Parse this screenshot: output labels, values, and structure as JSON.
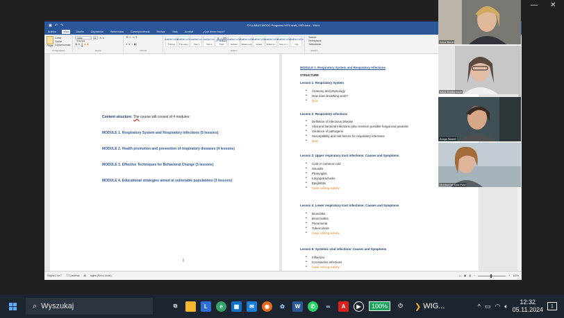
{
  "window": {
    "doc_title": "SYLLABUS MOOC Programa WP4 draft_V4Ů.docx - Word",
    "minimize": "—",
    "close": "✕"
  },
  "ribbon": {
    "tabs": [
      {
        "label": "Archivo"
      },
      {
        "label": "Inicio"
      },
      {
        "label": "Diseño"
      },
      {
        "label": "Disposición"
      },
      {
        "label": "Referencias"
      },
      {
        "label": "Correspondencia"
      },
      {
        "label": "Revisar"
      },
      {
        "label": "Vista"
      },
      {
        "label": "Acrobat"
      }
    ],
    "tell_me": "¿Qué desea hacer?",
    "clipboard": {
      "paste": "Pegar",
      "cut": "Cortar",
      "copy": "Copiar",
      "format_painter": "Copiar formato",
      "group": "Portapapeles"
    },
    "font": {
      "name": "Calibri (Cuerpo)",
      "size": "11",
      "group": "Fuente"
    },
    "paragraph": {
      "group": "Párrafo"
    },
    "styles": [
      {
        "sample": "AaBbCcDc",
        "name": "¶ Normal"
      },
      {
        "sample": "AaBbCcDc",
        "name": "¶ Sin espa..."
      },
      {
        "sample": "AaBbCcL",
        "name": "Título 1"
      },
      {
        "sample": "AaBbCcL",
        "name": "Título 2"
      },
      {
        "sample": "AaB",
        "name": "Título"
      },
      {
        "sample": "AaBbCcDc",
        "name": "Subtítulo"
      },
      {
        "sample": "AaBbCcDc",
        "name": "Énfasis sutil"
      },
      {
        "sample": "AaBbCcDc",
        "name": "Énfasis"
      },
      {
        "sample": "AaBbCcDc",
        "name": "Énfasis int..."
      },
      {
        "sample": "AaBbCcDc",
        "name": "Texto en n..."
      },
      {
        "sample": "AaBbCcDc",
        "name": "Cita"
      }
    ],
    "styles_group": "Estilos",
    "editing": {
      "find": "Buscar",
      "replace": "Reemplazar",
      "select": "Seleccionar",
      "group": "Edición"
    }
  },
  "page1": {
    "intro_label": "Content structure:",
    "intro_the": "The",
    "intro_rest": "course will consist of 4 modules:",
    "modules": [
      "MODULE 1. Respiratory System and Respiratory Infections (5 lessons)",
      "MODULE 2. Health promotion and prevention of respiratory diseases (4 lessons)",
      "MODULE 3. Effective Techniques for Behavioral Change (3 lessons)",
      "MODULE 4. Educational strategies aimed at vulnerable populations (3 lessons)"
    ],
    "cursor": "I"
  },
  "page2": {
    "module_title": "MODULE 1. Respiratory System and Respiratory Infections",
    "structure": "STRUCTURE",
    "lessons": [
      {
        "title": "Lesson 1: Respiratory System",
        "items": [
          {
            "text": "Anatomy and physiology",
            "orange": false
          },
          {
            "text": "How does breathing work?",
            "orange": false
          },
          {
            "text": "Quiz",
            "orange": true
          }
        ]
      },
      {
        "title": "Lesson 2: Respiratory infections",
        "items": [
          {
            "text": "Definition of infectious disease",
            "orange": false
          },
          {
            "text": "Viral and bacterial infections (also mention possible fungal and parasitic",
            "orange": false
          },
          {
            "text": "Virulence of pathogens",
            "orange": false
          },
          {
            "text": "Susceptibility and risk factors for respiratory infections",
            "orange": false
          },
          {
            "text": "Quiz",
            "orange": true
          }
        ]
      },
      {
        "title": "Lesson 3: Upper respiratory tract infections: Causes and Symptoms",
        "items": [
          {
            "text": "Cold or common cold",
            "orange": false
          },
          {
            "text": "Sinusitis",
            "orange": false
          },
          {
            "text": "Pharyngitis",
            "orange": false
          },
          {
            "text": "Laryngotracheitis",
            "orange": false
          },
          {
            "text": "Epiglottitis",
            "orange": false
          },
          {
            "text": "Case solving activity",
            "orange": true
          }
        ]
      },
      {
        "title": "Lesson 4: Lower respiratory tract infections: Causes and Symptoms",
        "items": [
          {
            "text": "Bronchitis",
            "orange": false
          },
          {
            "text": "Bronchiolitis",
            "orange": false
          },
          {
            "text": "Pneumonia",
            "orange": false
          },
          {
            "text": "Tuberculosis",
            "orange": false
          },
          {
            "text": "Case solving activity",
            "orange": true
          }
        ]
      },
      {
        "title": "Lesson 5: Systemic viral infections: Causes and Symptoms",
        "items": [
          {
            "text": "Influenza",
            "orange": false
          },
          {
            "text": "Coronavirus infections",
            "orange": false
          },
          {
            "text": "Case solving activity",
            "orange": true
          }
        ]
      }
    ]
  },
  "statusbar": {
    "page": "Página 2 de 7",
    "words": "777 palabras",
    "lang": "Inglés (Reino Unido)",
    "zoom": "100%"
  },
  "participants": [
    {
      "name": "Anna Bona"
    },
    {
      "name": "Aiara Dobilovidule"
    },
    {
      "name": "Aurga Sbaret"
    },
    {
      "name": "Montserrat Solà Pola"
    }
  ],
  "taskbar": {
    "search_placeholder": "Wyszukaj",
    "battery": "100%",
    "app_label": "WIG...",
    "time": "12:32",
    "date": "05.11.2024",
    "notifications": "1"
  }
}
